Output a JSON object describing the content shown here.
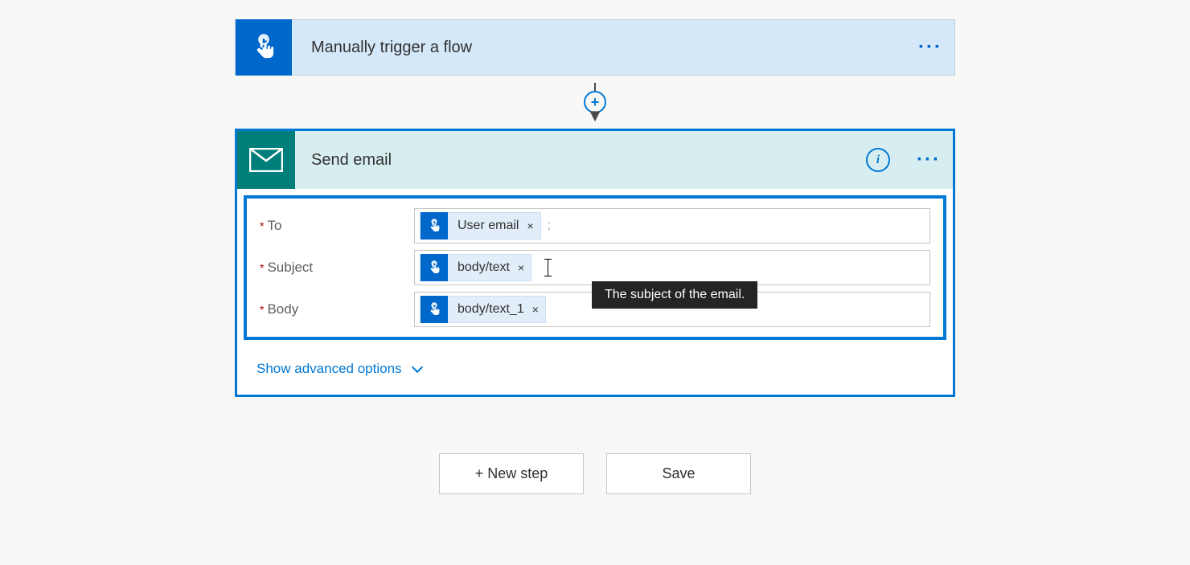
{
  "trigger": {
    "title": "Manually trigger a flow"
  },
  "connector": {
    "add_label": "+"
  },
  "action": {
    "title": "Send email",
    "info_label": "i",
    "fields": [
      {
        "label": "To",
        "required_mark": "*",
        "token": "User email",
        "token_x": "×",
        "trailing": ";"
      },
      {
        "label": "Subject",
        "required_mark": "*",
        "token": "body/text",
        "token_x": "×",
        "tooltip": "The subject of the email."
      },
      {
        "label": "Body",
        "required_mark": "*",
        "token": "body/text_1",
        "token_x": "×"
      }
    ],
    "advanced_label": "Show advanced options"
  },
  "buttons": {
    "new_step": "+ New step",
    "save": "Save"
  }
}
